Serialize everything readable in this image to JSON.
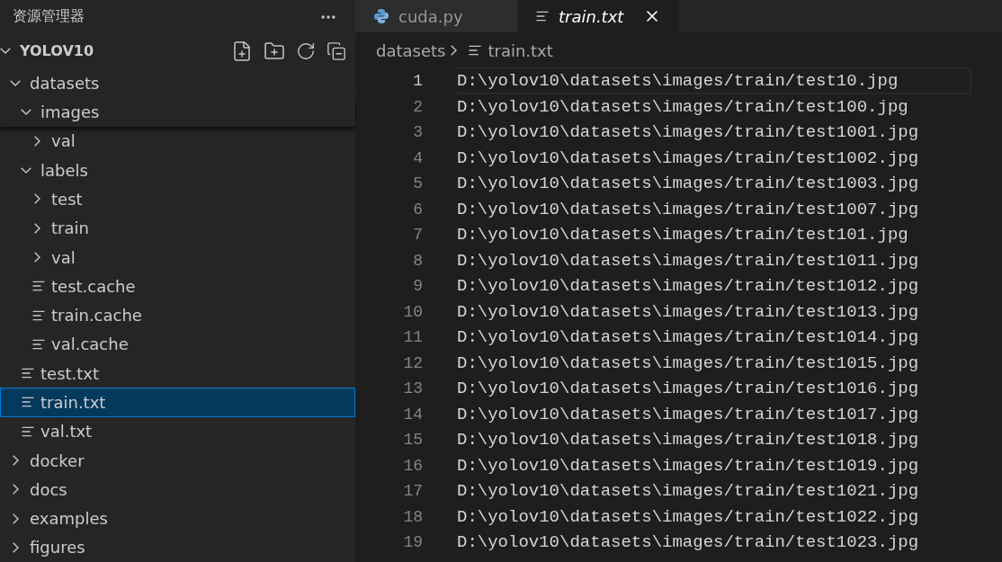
{
  "sidebar": {
    "title": "资源管理器",
    "root": {
      "label": "YOLOV10",
      "expanded": true
    },
    "tree": [
      {
        "kind": "folder",
        "label": "datasets",
        "expanded": true,
        "selected": false,
        "children": [
          {
            "kind": "folder",
            "label": "images",
            "expanded": true,
            "selected": false,
            "sticky": true,
            "children": [
              {
                "kind": "folder",
                "label": "val",
                "expanded": false,
                "selected": false
              }
            ]
          },
          {
            "kind": "folder",
            "label": "labels",
            "expanded": true,
            "selected": false,
            "children": [
              {
                "kind": "folder",
                "label": "test",
                "expanded": false,
                "selected": false
              },
              {
                "kind": "folder",
                "label": "train",
                "expanded": false,
                "selected": false
              },
              {
                "kind": "folder",
                "label": "val",
                "expanded": false,
                "selected": false
              },
              {
                "kind": "file",
                "label": "test.cache",
                "selected": false
              },
              {
                "kind": "file",
                "label": "train.cache",
                "selected": false
              },
              {
                "kind": "file",
                "label": "val.cache",
                "selected": false
              }
            ]
          },
          {
            "kind": "file",
            "label": "test.txt",
            "selected": false
          },
          {
            "kind": "file",
            "label": "train.txt",
            "selected": true
          },
          {
            "kind": "file",
            "label": "val.txt",
            "selected": false
          }
        ]
      },
      {
        "kind": "folder",
        "label": "docker",
        "expanded": false,
        "selected": false
      },
      {
        "kind": "folder",
        "label": "docs",
        "expanded": false,
        "selected": false
      },
      {
        "kind": "folder",
        "label": "examples",
        "expanded": false,
        "selected": false
      },
      {
        "kind": "folder",
        "label": "figures",
        "expanded": false,
        "selected": false
      }
    ]
  },
  "tabs": [
    {
      "label": "cuda.py",
      "kind": "python",
      "selected": false,
      "preview": false
    },
    {
      "label": "train.txt",
      "kind": "text",
      "selected": true,
      "preview": true
    }
  ],
  "breadcrumb": [
    "datasets",
    "train.txt"
  ],
  "lines": [
    {
      "number": "1",
      "text": "D:\\yolov10\\datasets\\images/train/test10.jpg",
      "current": true
    },
    {
      "number": "2",
      "text": "D:\\yolov10\\datasets\\images/train/test100.jpg",
      "current": false
    },
    {
      "number": "3",
      "text": "D:\\yolov10\\datasets\\images/train/test1001.jpg",
      "current": false
    },
    {
      "number": "4",
      "text": "D:\\yolov10\\datasets\\images/train/test1002.jpg",
      "current": false
    },
    {
      "number": "5",
      "text": "D:\\yolov10\\datasets\\images/train/test1003.jpg",
      "current": false
    },
    {
      "number": "6",
      "text": "D:\\yolov10\\datasets\\images/train/test1007.jpg",
      "current": false
    },
    {
      "number": "7",
      "text": "D:\\yolov10\\datasets\\images/train/test101.jpg",
      "current": false
    },
    {
      "number": "8",
      "text": "D:\\yolov10\\datasets\\images/train/test1011.jpg",
      "current": false
    },
    {
      "number": "9",
      "text": "D:\\yolov10\\datasets\\images/train/test1012.jpg",
      "current": false
    },
    {
      "number": "10",
      "text": "D:\\yolov10\\datasets\\images/train/test1013.jpg",
      "current": false
    },
    {
      "number": "11",
      "text": "D:\\yolov10\\datasets\\images/train/test1014.jpg",
      "current": false
    },
    {
      "number": "12",
      "text": "D:\\yolov10\\datasets\\images/train/test1015.jpg",
      "current": false
    },
    {
      "number": "13",
      "text": "D:\\yolov10\\datasets\\images/train/test1016.jpg",
      "current": false
    },
    {
      "number": "14",
      "text": "D:\\yolov10\\datasets\\images/train/test1017.jpg",
      "current": false
    },
    {
      "number": "15",
      "text": "D:\\yolov10\\datasets\\images/train/test1018.jpg",
      "current": false
    },
    {
      "number": "16",
      "text": "D:\\yolov10\\datasets\\images/train/test1019.jpg",
      "current": false
    },
    {
      "number": "17",
      "text": "D:\\yolov10\\datasets\\images/train/test1021.jpg",
      "current": false
    },
    {
      "number": "18",
      "text": "D:\\yolov10\\datasets\\images/train/test1022.jpg",
      "current": false
    },
    {
      "number": "19",
      "text": "D:\\yolov10\\datasets\\images/train/test1023.jpg",
      "current": false
    }
  ]
}
